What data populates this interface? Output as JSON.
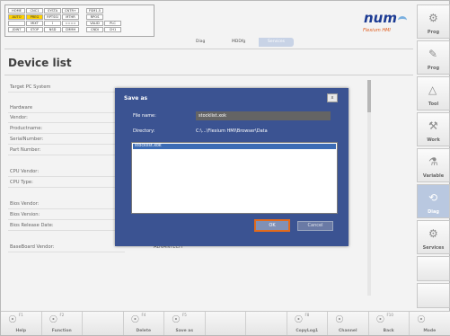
{
  "status": [
    [
      "HOME",
      "CNC1",
      "SYSTA",
      "CNTR+"
    ],
    [
      "AUTO",
      "PREG",
      "RPTSSI",
      "MTHR"
    ],
    [
      "",
      "MIXT",
      "I",
      "===="
    ],
    [
      "JOINT",
      "STOP",
      "NSD",
      "CMMH"
    ],
    [
      "",
      "",
      "FSM1.5",
      ""
    ],
    [
      "",
      "",
      "RPOS",
      ""
    ],
    [
      "",
      "",
      "VALID",
      "PLC"
    ],
    [
      "",
      "",
      "CNDI",
      "CH1"
    ]
  ],
  "logo": {
    "text": "num",
    "tagline": "Flexium HMI"
  },
  "breadcrumbs": [
    "Diag",
    "MDDfg",
    "Services"
  ],
  "page_title": "Device list",
  "fields": [
    {
      "label": "Target PC System",
      "value": ""
    },
    {
      "label": "Hardware",
      "value": ""
    },
    {
      "label": "Vendor:",
      "value": ""
    },
    {
      "label": "Productname:",
      "value": ""
    },
    {
      "label": "SerialNumber:",
      "value": ""
    },
    {
      "label": "Part Number:",
      "value": ""
    },
    {
      "label": "CPU Vendor:",
      "value": ""
    },
    {
      "label": "CPU Type:",
      "value": ""
    },
    {
      "label": "Bios Vendor:",
      "value": ""
    },
    {
      "label": "Bios Version:",
      "value": ""
    },
    {
      "label": "Bios Release Date:",
      "value": "16/06/2010"
    },
    {
      "label": "BaseBoard Vendor:",
      "value": "ADVANTECH"
    }
  ],
  "dialog": {
    "title": "Save as",
    "close": "x",
    "file_name_label": "File name:",
    "file_name_value": "stocklist.xok",
    "directory_label": "Directory:",
    "directory_value": "C:\\...\\Flexium HMI\\Browser\\Data",
    "files": [
      "stocklist.xok"
    ],
    "ok": "OK",
    "cancel": "Cancel"
  },
  "side_softkeys": [
    {
      "label": "Prog",
      "icon": "gear-icon"
    },
    {
      "label": "Prog",
      "icon": "program-icon"
    },
    {
      "label": "Tool",
      "icon": "tool-icon"
    },
    {
      "label": "Work",
      "icon": "work-icon"
    },
    {
      "label": "Variable",
      "icon": "variable-icon"
    },
    {
      "label": "Diag",
      "icon": "diag-icon",
      "selected": true
    },
    {
      "label": "Services",
      "icon": "services-icon"
    }
  ],
  "bottom_softkeys": [
    {
      "label": "Help",
      "num": "F1"
    },
    {
      "label": "Function",
      "num": "F2"
    },
    {
      "label": "",
      "num": ""
    },
    {
      "label": "Delete",
      "num": "F4"
    },
    {
      "label": "Save as",
      "num": "F5"
    },
    {
      "label": "",
      "num": ""
    },
    {
      "label": "",
      "num": ""
    },
    {
      "label": "CopyLog1",
      "num": "F8"
    },
    {
      "label": "Channel",
      "num": ""
    },
    {
      "label": "Back",
      "num": "F10"
    },
    {
      "label": "Mode",
      "num": ""
    }
  ]
}
